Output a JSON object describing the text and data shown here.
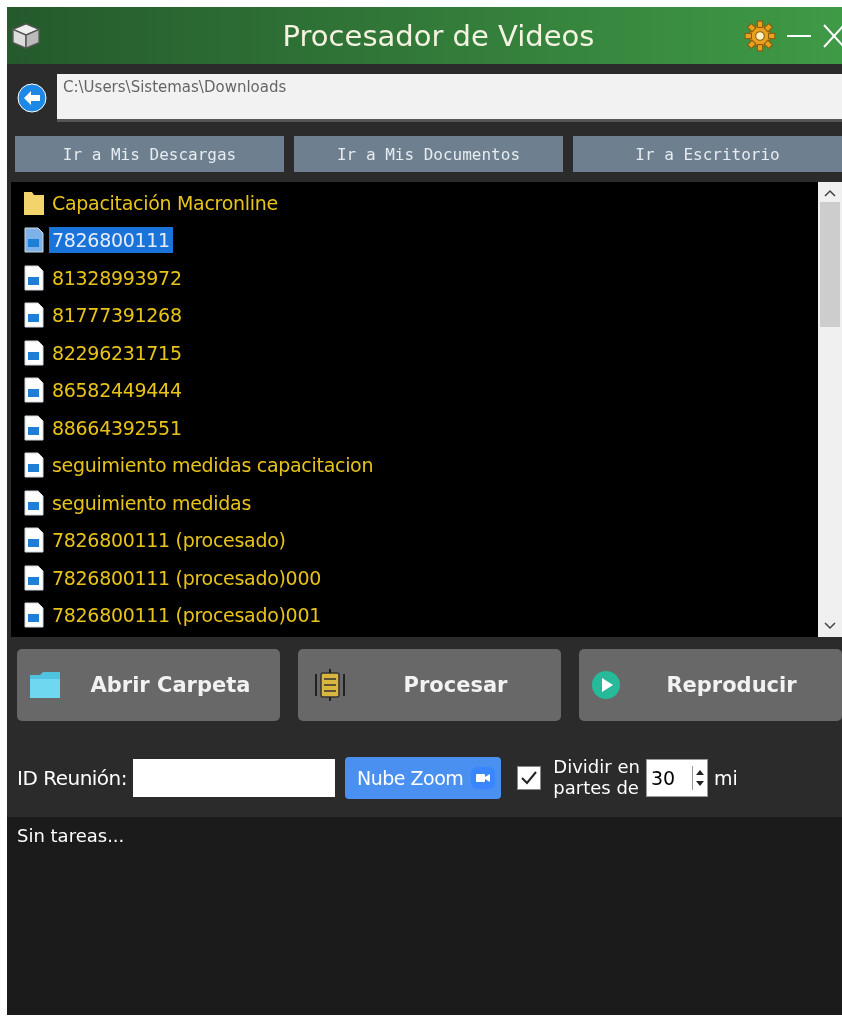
{
  "window": {
    "title": "Procesador de Videos"
  },
  "path_field": {
    "value": "C:\\Users\\Sistemas\\Downloads"
  },
  "nav_buttons": [
    "Ir a Mis Descargas",
    "Ir a Mis Documentos",
    "Ir a Escritorio"
  ],
  "file_list": [
    {
      "name": "Capacitación Macronline",
      "kind": "folder",
      "selected": false
    },
    {
      "name": "7826800111",
      "kind": "file",
      "selected": true
    },
    {
      "name": "81328993972",
      "kind": "file",
      "selected": false
    },
    {
      "name": "81777391268",
      "kind": "file",
      "selected": false
    },
    {
      "name": "82296231715",
      "kind": "file",
      "selected": false
    },
    {
      "name": "86582449444",
      "kind": "file",
      "selected": false
    },
    {
      "name": "88664392551",
      "kind": "file",
      "selected": false
    },
    {
      "name": "seguimiento medidas capacitacion",
      "kind": "file",
      "selected": false
    },
    {
      "name": "seguimiento medidas",
      "kind": "file",
      "selected": false
    },
    {
      "name": "7826800111 (procesado)",
      "kind": "file",
      "selected": false
    },
    {
      "name": "7826800111 (procesado)000",
      "kind": "file",
      "selected": false
    },
    {
      "name": "7826800111 (procesado)001",
      "kind": "file",
      "selected": false
    }
  ],
  "action_buttons": [
    {
      "label": "Abrir Carpeta",
      "kind": "folder"
    },
    {
      "label": "Procesar",
      "kind": "process"
    },
    {
      "label": "Reproducir",
      "kind": "play"
    }
  ],
  "meeting": {
    "label": "ID Reunión:",
    "zoom_button": "Nube Zoom"
  },
  "split": {
    "checked": true,
    "label": "Dividir en\npartes de",
    "value": "30",
    "unit": "mi"
  },
  "status_text": "Sin tareas..."
}
